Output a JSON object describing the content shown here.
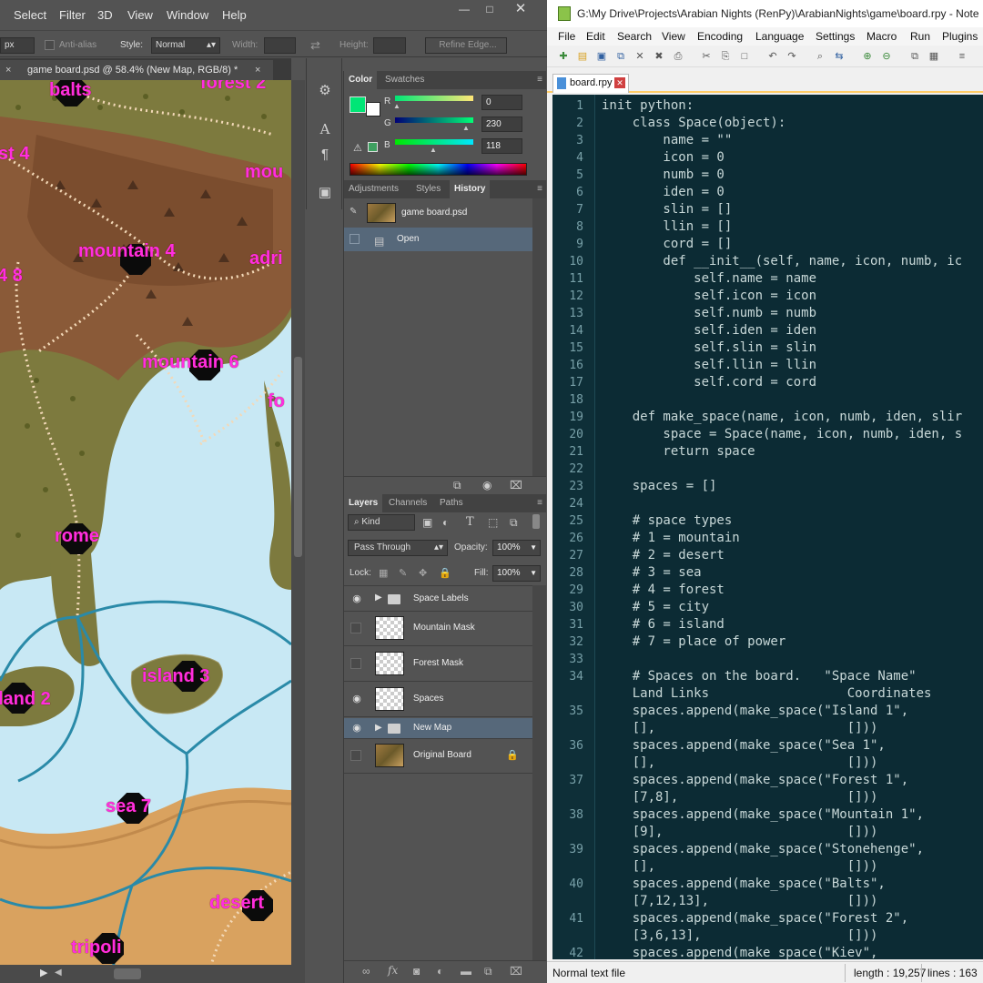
{
  "photoshop": {
    "menu": [
      "Select",
      "Filter",
      "3D",
      "View",
      "Window",
      "Help"
    ],
    "options": {
      "size_value": "px",
      "anti_alias": "Anti-alias",
      "style_label": "Style:",
      "style_value": "Normal",
      "width_label": "Width:",
      "height_label": "Height:",
      "refine_edge": "Refine Edge..."
    },
    "document_tab": "game board.psd @ 58.4% (New Map, RGB/8) *",
    "map_labels": {
      "balts": "balts",
      "forest2": "forest 2",
      "forest4": "st 4",
      "mountain_right": "mou",
      "mountain4": "mountain 4",
      "adri": "adri",
      "left4": "4 8",
      "mountain6": "mountain 6",
      "fo": "fo",
      "rome": "rome",
      "island3": "island 3",
      "island2": "land 2",
      "sea7": "sea 7",
      "desert": "desert",
      "tripoli": "tripoli"
    },
    "color_panel": {
      "tabs": [
        "Color",
        "Swatches"
      ],
      "r_label": "R",
      "r_value": "0",
      "g_label": "G",
      "g_value": "230",
      "b_label": "B",
      "b_value": "118",
      "foreground": "#00e676"
    },
    "history_panel": {
      "tabs": [
        "Adjustments",
        "Styles",
        "History"
      ],
      "snapshot": "game board.psd",
      "states": [
        "Open"
      ]
    },
    "layers_panel": {
      "tabs": [
        "Layers",
        "Channels",
        "Paths"
      ],
      "kind": "Kind",
      "blend_mode": "Pass Through",
      "opacity_label": "Opacity:",
      "opacity_value": "100%",
      "lock_label": "Lock:",
      "fill_label": "Fill:",
      "fill_value": "100%",
      "layers": [
        "Space Labels",
        "Mountain Mask",
        "Forest Mask",
        "Spaces",
        "New Map",
        "Original Board"
      ]
    }
  },
  "notepad": {
    "title": "G:\\My Drive\\Projects\\Arabian Nights (RenPy)\\ArabianNights\\game\\board.rpy - Note",
    "menu": [
      "File",
      "Edit",
      "Search",
      "View",
      "Encoding",
      "Language",
      "Settings",
      "Macro",
      "Run",
      "Plugins"
    ],
    "tab": "board.rpy",
    "lines": [
      {
        "n": "1",
        "t": "init python:"
      },
      {
        "n": "2",
        "t": "    class Space(object):"
      },
      {
        "n": "3",
        "t": "        name = \"\""
      },
      {
        "n": "4",
        "t": "        icon = 0"
      },
      {
        "n": "5",
        "t": "        numb = 0"
      },
      {
        "n": "6",
        "t": "        iden = 0"
      },
      {
        "n": "7",
        "t": "        slin = []"
      },
      {
        "n": "8",
        "t": "        llin = []"
      },
      {
        "n": "9",
        "t": "        cord = []"
      },
      {
        "n": "10",
        "t": "        def __init__(self, name, icon, numb, ic"
      },
      {
        "n": "11",
        "t": "            self.name = name"
      },
      {
        "n": "12",
        "t": "            self.icon = icon"
      },
      {
        "n": "13",
        "t": "            self.numb = numb"
      },
      {
        "n": "14",
        "t": "            self.iden = iden"
      },
      {
        "n": "15",
        "t": "            self.slin = slin"
      },
      {
        "n": "16",
        "t": "            self.llin = llin"
      },
      {
        "n": "17",
        "t": "            self.cord = cord"
      },
      {
        "n": "18",
        "t": ""
      },
      {
        "n": "19",
        "t": "    def make_space(name, icon, numb, iden, slir"
      },
      {
        "n": "20",
        "t": "        space = Space(name, icon, numb, iden, s"
      },
      {
        "n": "21",
        "t": "        return space"
      },
      {
        "n": "22",
        "t": ""
      },
      {
        "n": "23",
        "t": "    spaces = []"
      },
      {
        "n": "24",
        "t": ""
      },
      {
        "n": "25",
        "t": "    # space types"
      },
      {
        "n": "26",
        "t": "    # 1 = mountain"
      },
      {
        "n": "27",
        "t": "    # 2 = desert"
      },
      {
        "n": "28",
        "t": "    # 3 = sea"
      },
      {
        "n": "29",
        "t": "    # 4 = forest"
      },
      {
        "n": "30",
        "t": "    # 5 = city"
      },
      {
        "n": "31",
        "t": "    # 6 = island"
      },
      {
        "n": "32",
        "t": "    # 7 = place of power"
      },
      {
        "n": "33",
        "t": ""
      },
      {
        "n": "34",
        "t": "    # Spaces on the board.   \"Space Name\""
      },
      {
        "n": "",
        "t": "    Land Links                  Coordinates"
      },
      {
        "n": "35",
        "t": "    spaces.append(make_space(\"Island 1\","
      },
      {
        "n": "",
        "t": "    [],                         []))"
      },
      {
        "n": "36",
        "t": "    spaces.append(make_space(\"Sea 1\","
      },
      {
        "n": "",
        "t": "    [],                         []))"
      },
      {
        "n": "37",
        "t": "    spaces.append(make_space(\"Forest 1\","
      },
      {
        "n": "",
        "t": "    [7,8],                      []))"
      },
      {
        "n": "38",
        "t": "    spaces.append(make_space(\"Mountain 1\","
      },
      {
        "n": "",
        "t": "    [9],                        []))"
      },
      {
        "n": "39",
        "t": "    spaces.append(make_space(\"Stonehenge\","
      },
      {
        "n": "",
        "t": "    [],                         []))"
      },
      {
        "n": "40",
        "t": "    spaces.append(make_space(\"Balts\","
      },
      {
        "n": "",
        "t": "    [7,12,13],                  []))"
      },
      {
        "n": "41",
        "t": "    spaces.append(make_space(\"Forest 2\","
      },
      {
        "n": "",
        "t": "    [3,6,13],                   []))"
      },
      {
        "n": "42",
        "t": "    spaces.append(make_space(\"Kiev\","
      }
    ],
    "status": {
      "type": "Normal text file",
      "length": "length : 19,257",
      "lines": "lines : 163"
    }
  }
}
